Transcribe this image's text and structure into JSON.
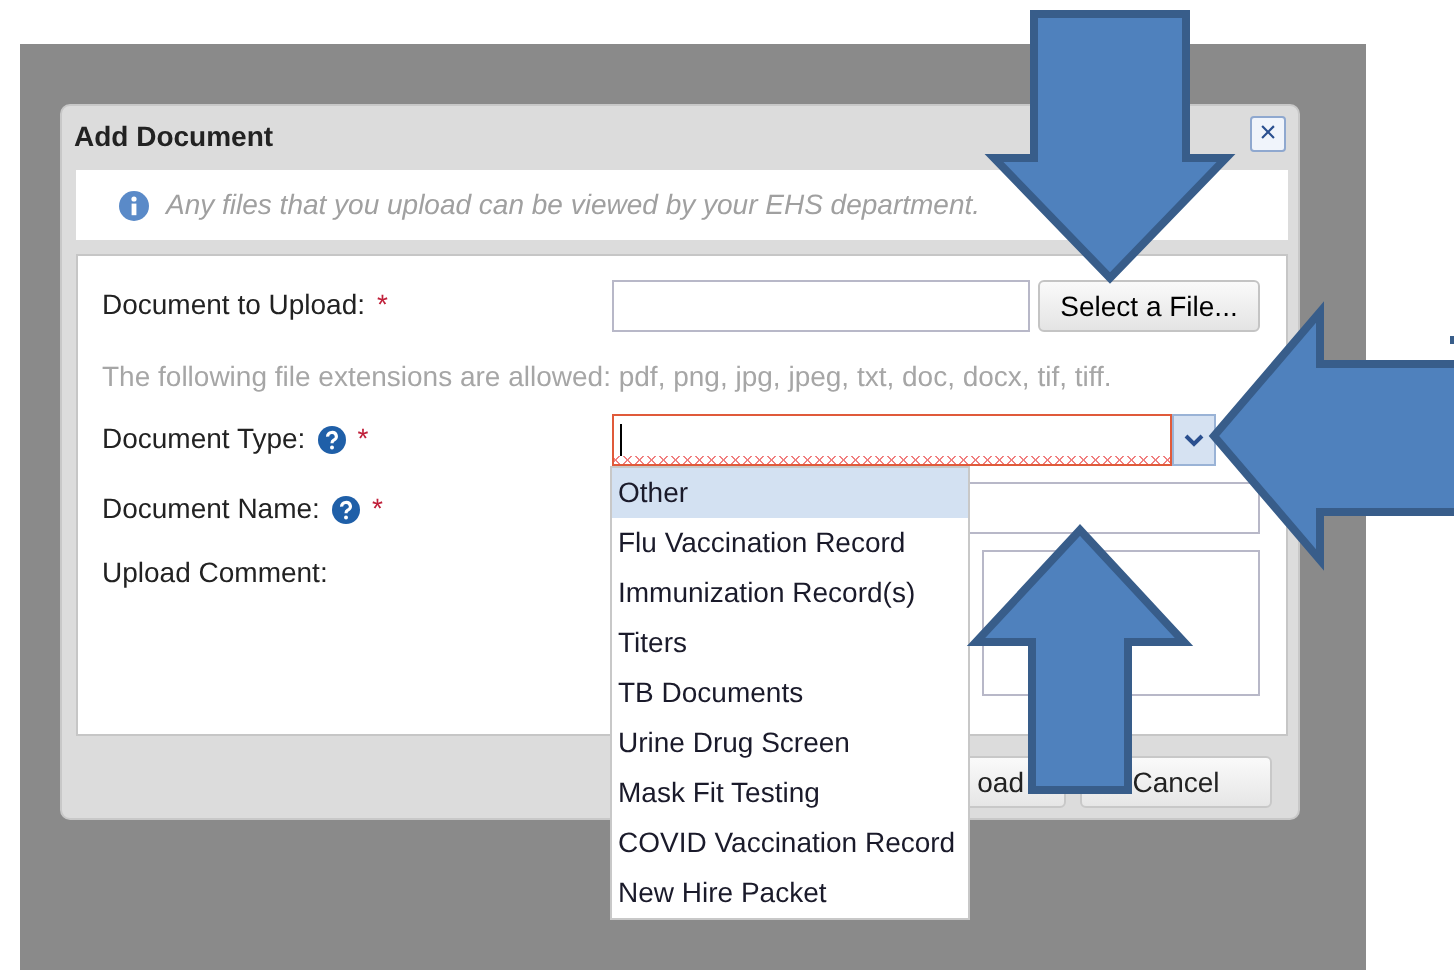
{
  "dialog": {
    "title": "Add Document",
    "close": "×"
  },
  "info": "Any files that you upload can be viewed by your EHS department.",
  "fields": [
    {
      "kind": "file",
      "label": "Document to Upload:",
      "required": "*",
      "button": "Select a File..."
    },
    {
      "kind": "hint",
      "text": "The following file extensions are allowed: pdf, png, jpg, jpeg, txt, doc, docx, tif, tiff."
    },
    {
      "kind": "combo",
      "label": "Document Type:",
      "required": "*",
      "help": true,
      "invalid": true,
      "expanded": true
    },
    {
      "kind": "text",
      "label": "Document Name:",
      "required": "*",
      "help": true
    },
    {
      "kind": "textarea",
      "label": "Upload Comment:"
    }
  ],
  "dropdown": [
    {
      "label": "Other",
      "selected": true
    },
    {
      "label": "Flu Vaccination Record",
      "selected": false
    },
    {
      "label": "Immunization Record(s)",
      "selected": false
    },
    {
      "label": "Titers",
      "selected": false
    },
    {
      "label": "TB Documents",
      "selected": false
    },
    {
      "label": "Urine Drug Screen",
      "selected": false
    },
    {
      "label": "Mask Fit Testing",
      "selected": false
    },
    {
      "label": "COVID Vaccination Record",
      "selected": false
    },
    {
      "label": "New Hire Packet",
      "selected": false
    }
  ],
  "buttons": [
    "oad",
    "Cancel"
  ],
  "arrows": [
    {
      "kind": "down"
    },
    {
      "kind": "left"
    },
    {
      "kind": "up"
    }
  ]
}
